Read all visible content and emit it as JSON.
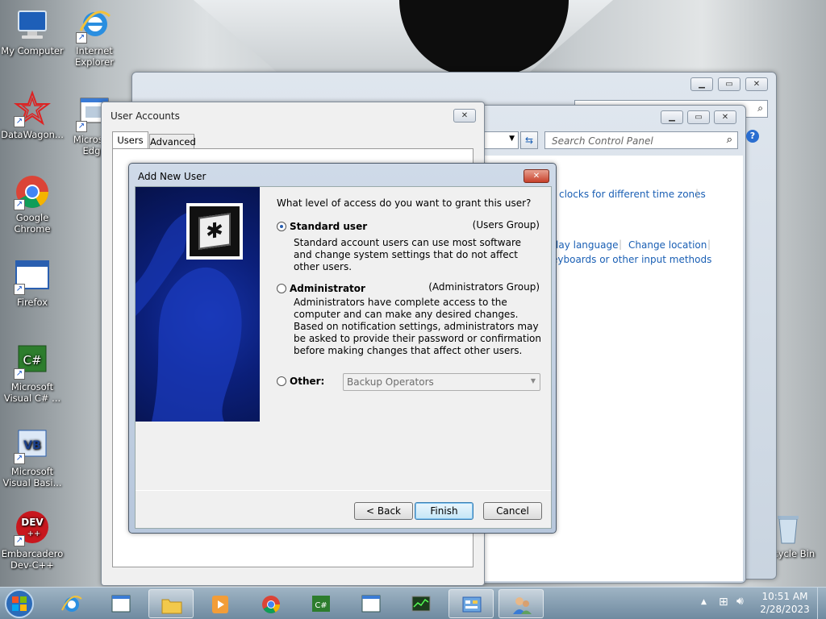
{
  "desktop": {
    "icons": [
      {
        "label": "My Computer",
        "icon": "computer-icon"
      },
      {
        "label": "Internet Explorer",
        "icon": "ie-icon"
      },
      {
        "label": "DataWagon...",
        "icon": "datawagon-icon"
      },
      {
        "label": "Microsoft Edge",
        "icon": "edge-icon"
      },
      {
        "label": "Google Chrome",
        "icon": "chrome-icon"
      },
      {
        "label": "Firefox",
        "icon": "firefox-icon"
      },
      {
        "label": "Microsoft Visual C# ...",
        "icon": "csharp-icon"
      },
      {
        "label": "Microsoft Visual Basi...",
        "icon": "vb-icon"
      },
      {
        "label": "Embarcadero Dev-C++",
        "icon": "devcpp-icon"
      },
      {
        "label": "Recycle Bin",
        "icon": "recycle-bin-icon"
      }
    ]
  },
  "control_panel": {
    "search_placeholder": "Search Control Panel",
    "links": {
      "clocks": "clocks for different time zones",
      "display_language": "lay language",
      "change_location": "Change location",
      "keyboards": "eyboards or other input methods"
    }
  },
  "user_accounts": {
    "title": "User Accounts",
    "tabs": [
      "Users",
      "Advanced"
    ]
  },
  "add_user": {
    "title": "Add New User",
    "question": "What level of access do you want to grant this user?",
    "options": [
      {
        "label": "Standard user",
        "group": "(Users Group)",
        "desc": "Standard account users can use most software and change system settings that do not affect other users.",
        "selected": true
      },
      {
        "label": "Administrator",
        "group": "(Administrators Group)",
        "desc": "Administrators have complete access to the computer and can make any desired changes. Based on notification settings, administrators may be asked to provide their password or confirmation before making changes that affect other users.",
        "selected": false
      }
    ],
    "other_label": "Other:",
    "other_value": "Backup Operators",
    "buttons": {
      "back": "< Back",
      "finish": "Finish",
      "cancel": "Cancel"
    }
  },
  "taskbar": {
    "time": "10:51 AM",
    "date": "2/28/2023"
  },
  "colors": {
    "accent": "#1a5fb4",
    "dialog_banner": "#0a1a6e",
    "taskbar": "#7f97ab"
  }
}
